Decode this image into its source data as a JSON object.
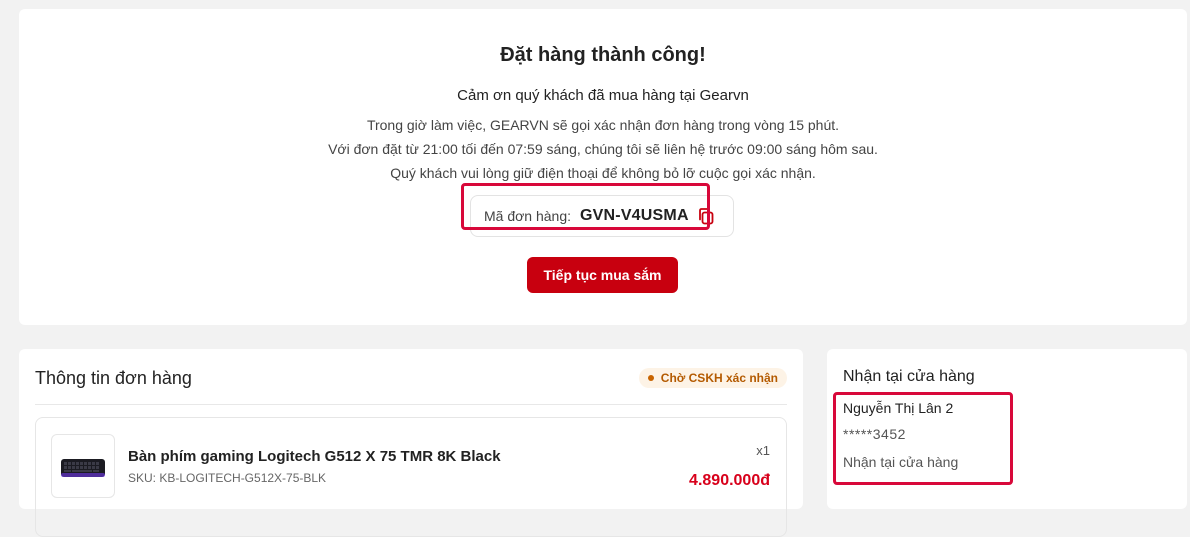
{
  "success": {
    "title": "Đặt hàng thành công!",
    "subtitle": "Cảm ơn quý khách đã mua hàng tại Gearvn",
    "messages": [
      "Trong giờ làm việc, GEARVN sẽ gọi xác nhận đơn hàng trong vòng 15 phút.",
      "Với đơn đặt từ 21:00 tối đến 07:59 sáng, chúng tôi sẽ liên hệ trước 09:00 sáng hôm sau.",
      "Quý khách vui lòng giữ điện thoại để không bỏ lỡ cuộc gọi xác nhận."
    ],
    "order_code_label": "Mã đơn hàng:",
    "order_code": "GVN-V4USMA",
    "continue_button": "Tiếp tục mua sắm"
  },
  "order_info": {
    "title": "Thông tin đơn hàng",
    "status": "Chờ CSKH xác nhận",
    "product": {
      "name": "Bàn phím gaming Logitech G512 X 75 TMR 8K Black",
      "sku": "SKU: KB-LOGITECH-G512X-75-BLK",
      "quantity": "x1",
      "price": "4.890.000đ"
    }
  },
  "pickup": {
    "title": "Nhận tại cửa hàng",
    "customer_name": "Nguyễn Thị Lân 2",
    "phone": "*****3452",
    "method": "Nhận tại cửa hàng"
  },
  "colors": {
    "accent": "#c8000f",
    "highlight": "#d8083a",
    "status_bg": "#fdf3e6",
    "status_text": "#b45a00",
    "price": "#d8001b"
  },
  "icons": {
    "copy": "copy-icon",
    "status": "status-dot-icon",
    "product": "keyboard-image"
  }
}
